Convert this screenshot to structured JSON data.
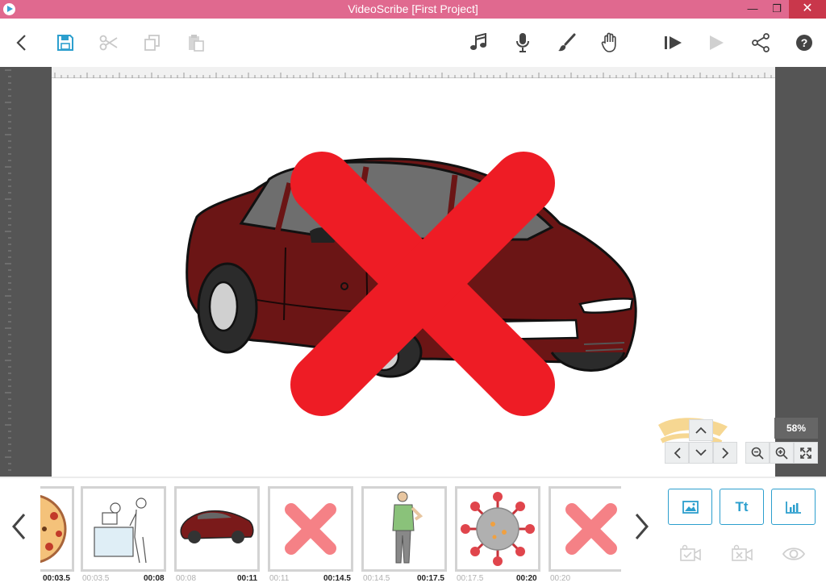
{
  "window": {
    "title": "VideoScribe [First Project]",
    "minimize": "—",
    "restore": "❐",
    "close": "✕"
  },
  "toolbar": {
    "left": [
      "back-icon",
      "save-icon",
      "cut-icon",
      "copy-icon",
      "paste-icon"
    ],
    "right": [
      "music-icon",
      "microphone-icon",
      "brush-icon",
      "hand-icon",
      "play-from-start-icon",
      "play-icon",
      "share-icon",
      "help-icon"
    ]
  },
  "canvas": {
    "zoom_label": "58%",
    "content": [
      "car-image",
      "red-cross-image"
    ]
  },
  "timeline": {
    "elements": [
      {
        "name": "pizza",
        "start": "",
        "end": "00:03.5"
      },
      {
        "name": "office-people",
        "start": "00:03.5",
        "end": "00:08"
      },
      {
        "name": "car",
        "start": "00:08",
        "end": "00:11"
      },
      {
        "name": "red-cross",
        "start": "00:11",
        "end": "00:14.5"
      },
      {
        "name": "man",
        "start": "00:14.5",
        "end": "00:17.5"
      },
      {
        "name": "virus",
        "start": "00:17.5",
        "end": "00:20"
      },
      {
        "name": "red-cross",
        "start": "00:20",
        "end": ""
      }
    ]
  },
  "add_buttons": {
    "text_label": "Tt"
  },
  "colors": {
    "titlebar": "#e0698f",
    "accent": "#2c9fce",
    "cross": "#ee1c25",
    "car": "#6b1515"
  }
}
